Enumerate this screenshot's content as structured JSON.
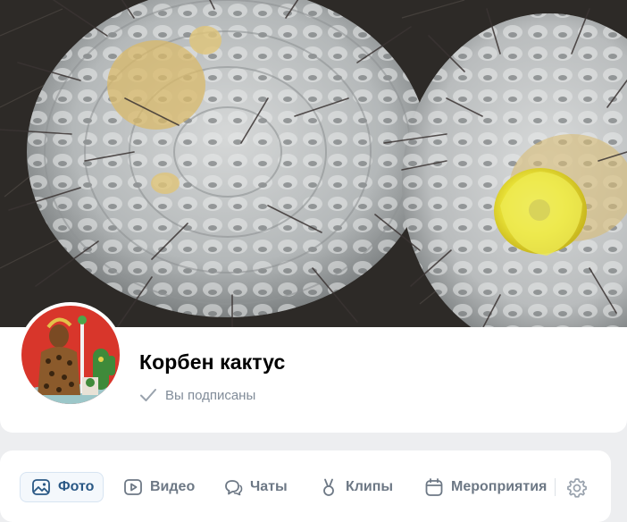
{
  "group": {
    "name": "Корбен кактус",
    "subscription_status": "Вы подписаны"
  },
  "tabs": [
    {
      "label": "Фото",
      "icon": "photo-icon",
      "active": true
    },
    {
      "label": "Видео",
      "icon": "video-icon",
      "active": false
    },
    {
      "label": "Чаты",
      "icon": "chats-icon",
      "active": false
    },
    {
      "label": "Клипы",
      "icon": "clips-icon",
      "active": false
    },
    {
      "label": "Мероприятия",
      "icon": "events-icon",
      "active": false
    }
  ],
  "icons": {
    "subscribed": "check-icon",
    "settings": "gear-icon"
  },
  "colors": {
    "accent": "#2a5885",
    "muted_text": "#818c99",
    "tab_text": "#6d7885",
    "page_bg": "#edeef0",
    "active_tab_bg": "#f4f8fc"
  }
}
